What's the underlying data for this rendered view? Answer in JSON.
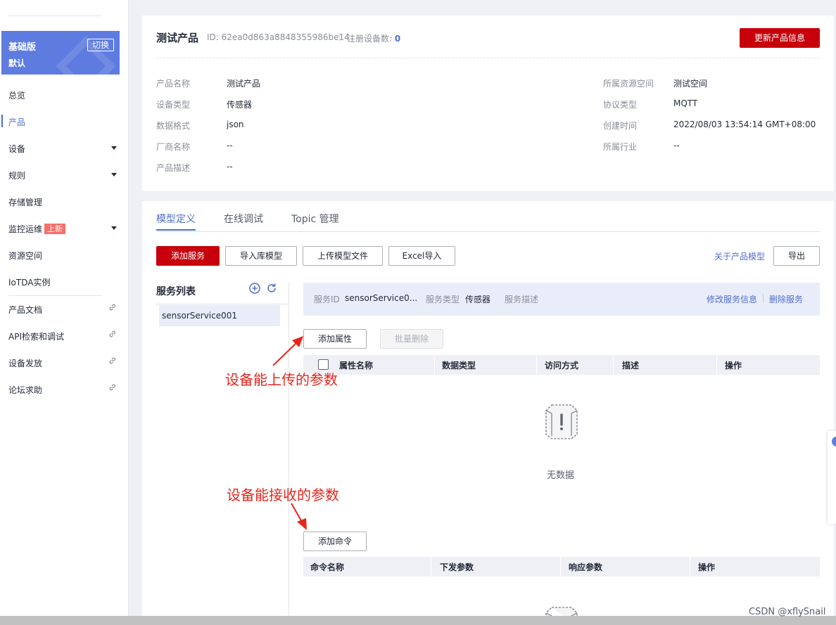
{
  "sidebar": {
    "edition_title": "基础版",
    "edition_sub": "默认",
    "switch_label": "切换",
    "items": [
      {
        "label": "总览"
      },
      {
        "label": "产品"
      },
      {
        "label": "设备"
      },
      {
        "label": "规则"
      },
      {
        "label": "存储管理"
      },
      {
        "label": "监控运维",
        "badge": "上新"
      },
      {
        "label": "资源空间"
      },
      {
        "label": "IoTDA实例"
      },
      {
        "label": "产品文档"
      },
      {
        "label": "API检索和调试"
      },
      {
        "label": "设备发放"
      },
      {
        "label": "论坛求助"
      }
    ]
  },
  "product": {
    "name_title": "测试产品",
    "id_text": "ID: 62ea0d863a8848355986be14",
    "registered_label": "注册设备数:",
    "registered_count": "0",
    "update_button": "更新产品信息",
    "info_left": [
      {
        "label": "产品名称",
        "value": "测试产品"
      },
      {
        "label": "设备类型",
        "value": "传感器"
      },
      {
        "label": "数据格式",
        "value": "json"
      },
      {
        "label": "厂商名称",
        "value": "--"
      },
      {
        "label": "产品描述",
        "value": "--"
      }
    ],
    "info_right": [
      {
        "label": "所属资源空间",
        "value": "测试空间"
      },
      {
        "label": "协议类型",
        "value": "MQTT"
      },
      {
        "label": "创建时间",
        "value": "2022/08/03 13:54:14 GMT+08:00"
      },
      {
        "label": "所属行业",
        "value": "--"
      }
    ]
  },
  "tabs": [
    "模型定义",
    "在线调试",
    "Topic 管理"
  ],
  "toolbar": {
    "add_service": "添加服务",
    "import_library": "导入库模型",
    "upload_model": "上传模型文件",
    "excel_import": "Excel导入",
    "about_model": "关于产品模型",
    "export": "导出"
  },
  "service_list": {
    "title": "服务列表",
    "items": [
      "sensorService001"
    ]
  },
  "service_bar": {
    "id_label": "服务ID",
    "id_value": "sensorService0...",
    "type_label": "服务类型",
    "type_value": "传感器",
    "desc_label": "服务描述",
    "edit_link": "修改服务信息",
    "delete_link": "删除服务"
  },
  "properties": {
    "add_button": "添加属性",
    "batch_delete": "批量删除",
    "columns": [
      "属性名称",
      "数据类型",
      "访问方式",
      "描述",
      "操作"
    ],
    "empty_text": "无数据"
  },
  "commands": {
    "add_button": "添加命令",
    "columns": [
      "命令名称",
      "下发参数",
      "响应参数",
      "操作"
    ]
  },
  "annotations": {
    "upload": "设备能上传的参数",
    "receive": "设备能接收的参数"
  },
  "watermark": "CSDN @xflySnail",
  "colors": {
    "brand_red": "#c7000b",
    "accent_blue": "#526ecc",
    "annotation_red": "#e8251c"
  }
}
